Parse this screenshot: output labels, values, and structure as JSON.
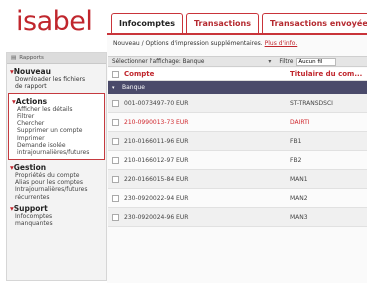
{
  "logo": "isabel",
  "tabs": [
    {
      "label": "Infocomptes",
      "active": true
    },
    {
      "label": "Transactions",
      "active": false
    },
    {
      "label": "Transactions envoyées",
      "active": false
    }
  ],
  "breadcrumb": {
    "text": "Nouveau / Options d'impression supplémentaires.",
    "link": "Plus d'info."
  },
  "sidebar": {
    "top": "Rapports",
    "nouveau": {
      "title": "Nouveau",
      "items": [
        "Downloader les fichiers",
        "de rapport"
      ]
    },
    "actions": {
      "title": "Actions",
      "items": [
        "Afficher les détails",
        "Filtrer",
        "Chercher",
        "Supprimer un compte",
        "Imprimer",
        "Demande isolée",
        "intrajournalières/futures"
      ]
    },
    "gestion": {
      "title": "Gestion",
      "items": [
        "Propriétés du compte",
        "Alias pour les comptes",
        "Intrajournalières/futures",
        "récurrentes"
      ]
    },
    "support": {
      "title": "Support",
      "items": [
        "Infocomptes",
        "manquantes"
      ]
    }
  },
  "filterbar": {
    "label": "Sélectionner l'affichage: Banque",
    "filtre": "Filtre",
    "input_value": "Aucun fil"
  },
  "table": {
    "headers": {
      "compte": "Compte",
      "titulaire": "Titulaire du com..."
    },
    "group": "Banque",
    "rows": [
      {
        "compte": "001-0073497-70 EUR",
        "titulaire": "ST-TRANSDSCI",
        "highlight": false
      },
      {
        "compte": "210-0990013-73 EUR",
        "titulaire": "DAIRTI",
        "highlight": true
      },
      {
        "compte": "210-0166011-96 EUR",
        "titulaire": "FB1",
        "highlight": false
      },
      {
        "compte": "210-0166012-97 EUR",
        "titulaire": "FB2",
        "highlight": false
      },
      {
        "compte": "220-0166015-84 EUR",
        "titulaire": "MAN1",
        "highlight": false
      },
      {
        "compte": "230-0920022-94 EUR",
        "titulaire": "MAN2",
        "highlight": false
      },
      {
        "compte": "230-0920024-96 EUR",
        "titulaire": "MAN3",
        "highlight": false
      }
    ]
  },
  "colors": {
    "accent": "#c0262d",
    "group_bar": "#4a4a6a"
  }
}
